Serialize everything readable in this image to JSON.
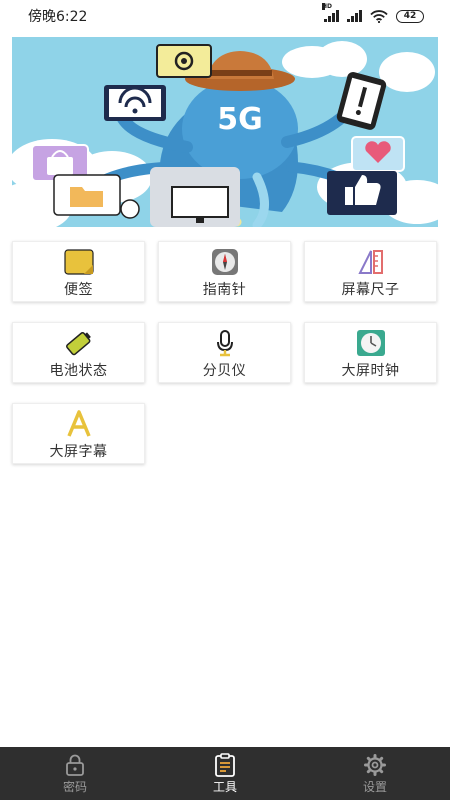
{
  "status_bar": {
    "time": "傍晚6:22",
    "network_badge": "HD",
    "battery_level": "42",
    "icons": [
      "hd-signal-icon",
      "signal-icon",
      "wifi-icon",
      "battery-icon"
    ]
  },
  "banner": {
    "label": "5G",
    "icons": [
      "at-sign-icon",
      "wifi-icon",
      "exclamation-phone-icon",
      "shopping-bag-icon",
      "folder-icon",
      "heart-icon",
      "thumbs-up-icon",
      "monitor-icon"
    ]
  },
  "tools": [
    {
      "label": "便签",
      "icon": "sticky-note-icon",
      "color": "#e8c23c"
    },
    {
      "label": "指南针",
      "icon": "compass-icon",
      "color": "#777777"
    },
    {
      "label": "屏幕尺子",
      "icon": "ruler-icon",
      "color": "#8a79c9"
    },
    {
      "label": "电池状态",
      "icon": "battery-status-icon",
      "color": "#c2cf3a"
    },
    {
      "label": "分贝仪",
      "icon": "microphone-icon",
      "color": "#222222"
    },
    {
      "label": "大屏时钟",
      "icon": "clock-icon",
      "color": "#3aa98f"
    },
    {
      "label": "大屏字幕",
      "icon": "letter-a-icon",
      "color": "#e8c23c"
    }
  ],
  "bottom_nav": {
    "items": [
      {
        "label": "密码",
        "icon": "lock-icon",
        "active": false
      },
      {
        "label": "工具",
        "icon": "clipboard-icon",
        "active": true
      },
      {
        "label": "设置",
        "icon": "gear-icon",
        "active": false
      }
    ],
    "background": "#2f2f2f"
  }
}
